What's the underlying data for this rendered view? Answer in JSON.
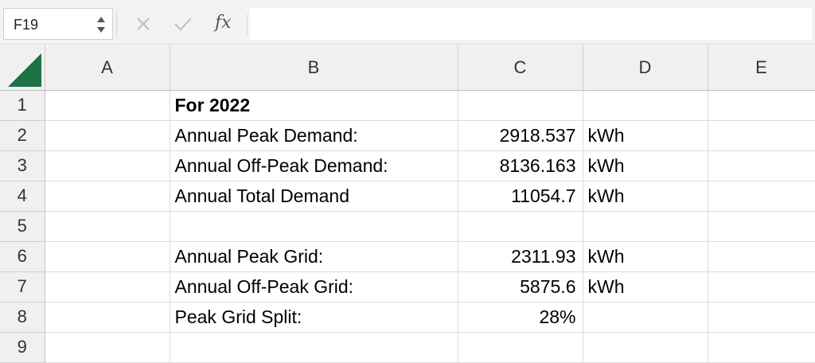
{
  "formula_bar": {
    "name_box": "F19",
    "formula": ""
  },
  "columns": [
    "A",
    "B",
    "C",
    "D",
    "E"
  ],
  "rows": [
    {
      "num": "1",
      "A": "",
      "B": "For 2022",
      "C": "",
      "D": "",
      "E": ""
    },
    {
      "num": "2",
      "A": "",
      "B": "Annual Peak Demand:",
      "C": "2918.537",
      "D": "kWh",
      "E": ""
    },
    {
      "num": "3",
      "A": "",
      "B": "Annual Off-Peak Demand:",
      "C": "8136.163",
      "D": "kWh",
      "E": ""
    },
    {
      "num": "4",
      "A": "",
      "B": "Annual Total Demand",
      "C": "11054.7",
      "D": "kWh",
      "E": ""
    },
    {
      "num": "5",
      "A": "",
      "B": "",
      "C": "",
      "D": "",
      "E": ""
    },
    {
      "num": "6",
      "A": "",
      "B": "Annual Peak Grid:",
      "C": "2311.93",
      "D": "kWh",
      "E": ""
    },
    {
      "num": "7",
      "A": "",
      "B": "Annual Off-Peak Grid:",
      "C": "5875.6",
      "D": "kWh",
      "E": ""
    },
    {
      "num": "8",
      "A": "",
      "B": "Peak Grid Split:",
      "C": "28%",
      "D": "",
      "E": ""
    },
    {
      "num": "9",
      "A": "",
      "B": "",
      "C": "",
      "D": "",
      "E": ""
    }
  ],
  "icons": {
    "cancel": "x-icon",
    "enter": "checkmark-icon",
    "function": "fx-icon",
    "select_all": "select-all-triangle-icon"
  },
  "colors": {
    "select_all": "#1e7145"
  }
}
